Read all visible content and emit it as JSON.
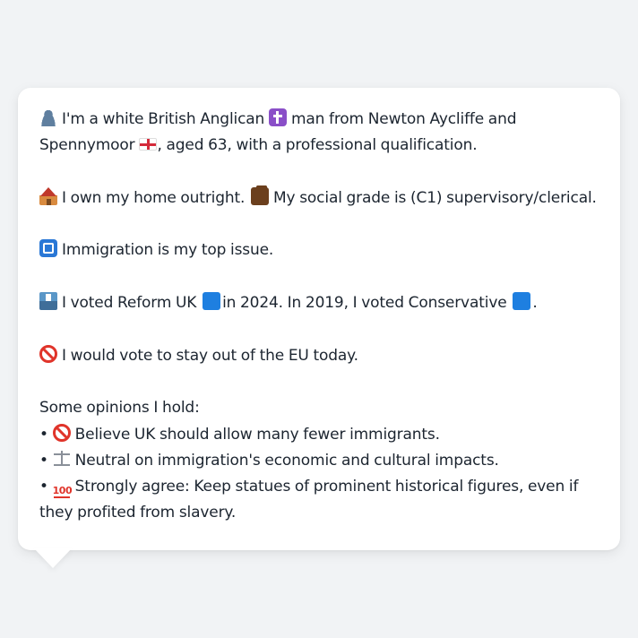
{
  "message": {
    "intro_line": "I'm a white British Anglican",
    "intro_line_2": "man from Newton Aycliffe and Spennymoor",
    "intro_line_3": ", aged 63, with a professional qualification.",
    "home": "I own my home outright.",
    "social_grade": "My social grade is (C1) supervisory/clerical.",
    "top_issue": "Immigration is my top issue.",
    "vote_2024_a": "I voted Reform UK",
    "vote_2024_b": "in 2024. In 2019, I voted Conservative",
    "vote_2024_c": ".",
    "eu": "I would vote to stay out of the EU today.",
    "opinions_heading": "Some opinions I hold:",
    "opinions": [
      "Believe UK should allow many fewer immigrants.",
      "Neutral on immigration's economic and cultural impacts.",
      "Strongly agree: Keep statues of prominent historical figures, even if they profited from slavery."
    ],
    "bullet": "•"
  },
  "icons": {
    "person": "bust-in-silhouette-icon",
    "cross": "latin-cross-icon",
    "flag": "england-flag-icon",
    "house": "house-icon",
    "briefcase": "briefcase-icon",
    "customs": "customs-icon",
    "ballot": "ballot-box-icon",
    "party_square": "blue-square-icon",
    "prohibited": "prohibited-icon",
    "scales": "balance-scale-icon",
    "hundred": "hundred-points-icon"
  },
  "colors": {
    "background": "#f1f3f5",
    "bubble": "#ffffff",
    "text": "#1c2530"
  }
}
